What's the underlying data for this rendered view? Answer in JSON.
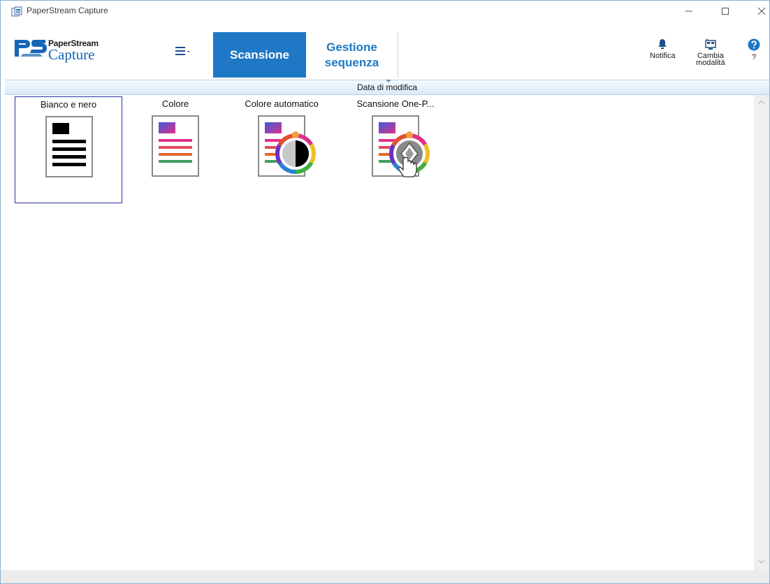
{
  "window": {
    "title": "PaperStream Capture"
  },
  "logo": {
    "top": "PaperStream",
    "bottom": "Capture"
  },
  "tabs": {
    "scan": "Scansione",
    "sequence_line1": "Gestione",
    "sequence_line2": "sequenza"
  },
  "actions": {
    "notify": "Notifica",
    "mode_line1": "Cambia",
    "mode_line2": "modalità",
    "help": "?"
  },
  "sort": {
    "label": "Data di modifica"
  },
  "profiles": [
    {
      "label": "Bianco e nero",
      "icon": "bw-document-icon",
      "selected": true
    },
    {
      "label": "Colore",
      "icon": "color-document-icon",
      "selected": false
    },
    {
      "label": "Colore automatico",
      "icon": "auto-color-document-icon",
      "selected": false
    },
    {
      "label": "Scansione One-P...",
      "icon": "one-push-scan-icon",
      "selected": false
    }
  ],
  "colors": {
    "accent": "#1f78c6",
    "selection": "#2830a8"
  }
}
